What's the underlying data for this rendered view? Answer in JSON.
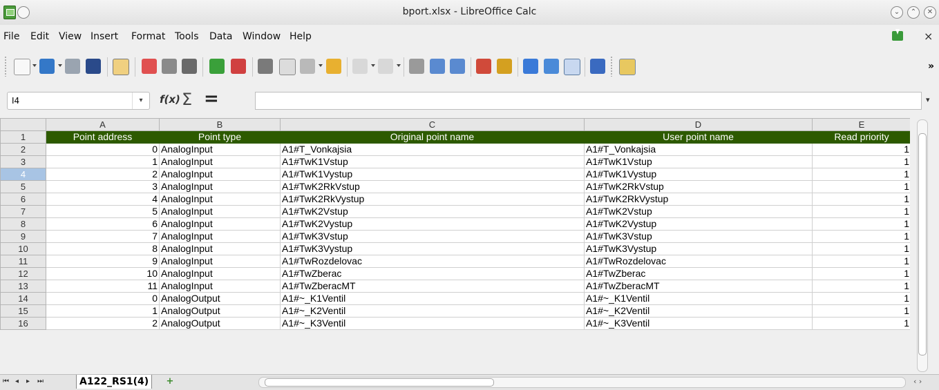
{
  "window": {
    "title": "bport.xlsx - LibreOffice Calc"
  },
  "menu": [
    "File",
    "Edit",
    "View",
    "Insert",
    "Format",
    "Tools",
    "Data",
    "Window",
    "Help"
  ],
  "namebox": {
    "value": "I4"
  },
  "columns": [
    "A",
    "B",
    "C",
    "D",
    "E"
  ],
  "header_row": [
    "Point address",
    "Point type",
    "Original point name",
    "User point name",
    "Read priority"
  ],
  "rows": [
    [
      "0",
      "AnalogInput",
      "A1#T_Vonkajsia",
      "A1#T_Vonkajsia",
      "1"
    ],
    [
      "1",
      "AnalogInput",
      "A1#TwK1Vstup",
      "A1#TwK1Vstup",
      "1"
    ],
    [
      "2",
      "AnalogInput",
      "A1#TwK1Vystup",
      "A1#TwK1Vystup",
      "1"
    ],
    [
      "3",
      "AnalogInput",
      "A1#TwK2RkVstup",
      "A1#TwK2RkVstup",
      "1"
    ],
    [
      "4",
      "AnalogInput",
      "A1#TwK2RkVystup",
      "A1#TwK2RkVystup",
      "1"
    ],
    [
      "5",
      "AnalogInput",
      "A1#TwK2Vstup",
      "A1#TwK2Vstup",
      "1"
    ],
    [
      "6",
      "AnalogInput",
      "A1#TwK2Vystup",
      "A1#TwK2Vystup",
      "1"
    ],
    [
      "7",
      "AnalogInput",
      "A1#TwK3Vstup",
      "A1#TwK3Vstup",
      "1"
    ],
    [
      "8",
      "AnalogInput",
      "A1#TwK3Vystup",
      "A1#TwK3Vystup",
      "1"
    ],
    [
      "9",
      "AnalogInput",
      "A1#TwRozdelovac",
      "A1#TwRozdelovac",
      "1"
    ],
    [
      "10",
      "AnalogInput",
      "A1#TwZberac",
      "A1#TwZberac",
      "1"
    ],
    [
      "11",
      "AnalogInput",
      "A1#TwZberacMT",
      "A1#TwZberacMT",
      "1"
    ],
    [
      "0",
      "AnalogOutput",
      "A1#~_K1Ventil",
      "A1#~_K1Ventil",
      "1"
    ],
    [
      "1",
      "AnalogOutput",
      "A1#~_K2Ventil",
      "A1#~_K2Ventil",
      "1"
    ],
    [
      "2",
      "AnalogOutput",
      "A1#~_K3Ventil",
      "A1#~_K3Ventil",
      "1"
    ]
  ],
  "selected_row": 4,
  "sheet_tab": "A122_RS1(4)",
  "colors": {
    "header_fill": "#2d5a00",
    "header_text": "#ffffff",
    "selected_row_header": "#a8c4e4"
  }
}
